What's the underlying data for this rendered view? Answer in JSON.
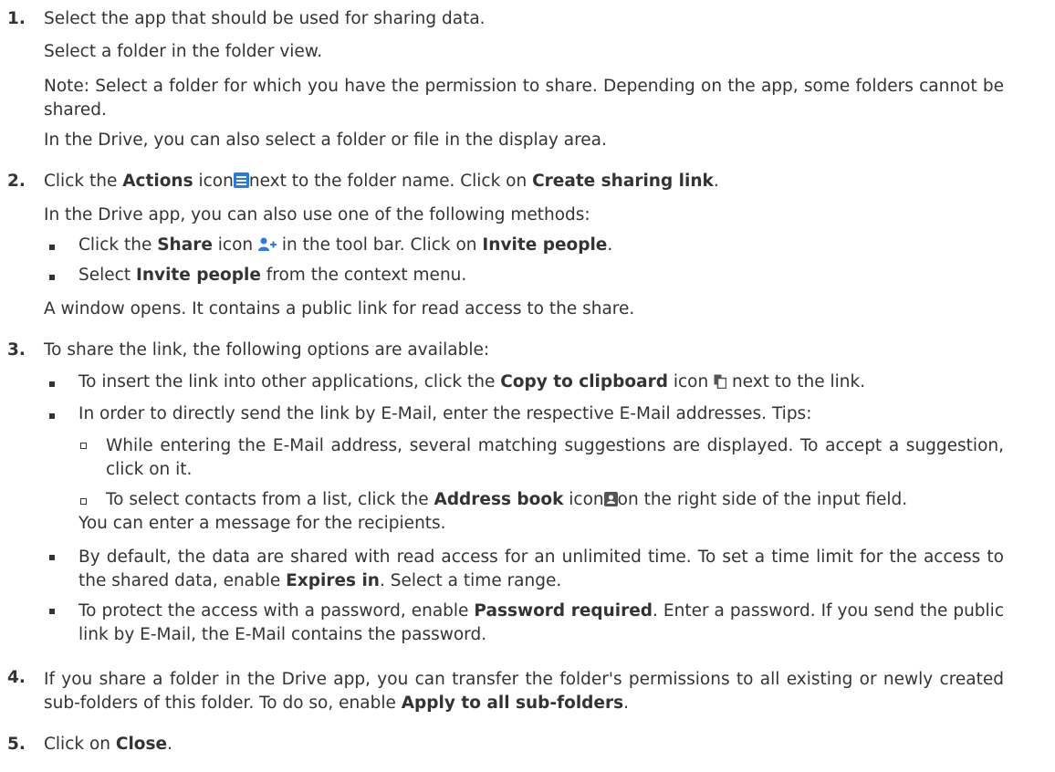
{
  "step1": {
    "number": "1.",
    "text": "Select the app that should be used for sharing data.",
    "select_folder": "Select a folder in the folder view.",
    "note": "Note: Select a folder for which you have the permission to share. Depending on the app, some folders cannot be shared.",
    "drive_note": "In the Drive, you can also select a folder or file in the display area."
  },
  "step2": {
    "number": "2.",
    "click": "Click the ",
    "actions": "Actions",
    "icon_word": " icon",
    "next_to": "next to the folder name. Click on ",
    "create_link": "Create sharing link",
    "period": ".",
    "drive_methods": "In the Drive app, you can also use one of the following methods:",
    "b1_click": "Click the ",
    "b1_share": "Share",
    "b1_icon": " icon ",
    "b1_toolbar": " in the tool bar. Click on ",
    "b1_invite": "Invite people",
    "b1_period": ".",
    "b2_select": "Select ",
    "b2_invite": "Invite people",
    "b2_rest": " from the context menu.",
    "window_opens": "A window opens. It contains a public link for read access to the share."
  },
  "step3": {
    "number": "3.",
    "intro": "To share the link, the following options are available:",
    "o1_a": "To insert the link into other applications, click the ",
    "o1_b": "Copy to clipboard",
    "o1_c": " icon ",
    "o1_d": " next to the link.",
    "o2": "In order to directly send the link by E-Mail, enter the respective E-Mail addresses. Tips:",
    "t1": "While entering the E-Mail address, several matching suggestions are displayed. To accept a suggestion, click on it.",
    "t2_a": "To select contacts from a list, click the ",
    "t2_b": "Address book",
    "t2_c": " icon",
    "t2_d": "on the right side of the input field.",
    "t2_e": "You can enter a message for the recipients.",
    "o3_a": "By default, the data are shared with read access for an unlimited time. To set a time limit for the access to the shared data, enable ",
    "o3_b": "Expires in",
    "o3_c": ". Select a time range.",
    "o4_a": "To protect the access with a password, enable ",
    "o4_b": "Password required",
    "o4_c": ". Enter a password. If you send the public link by E-Mail, the E-Mail contains the password."
  },
  "step4": {
    "number": "4.",
    "text": "If you share a folder in the Drive app, you can transfer the folder's permissions to all existing or newly created sub-folders of this folder. To do so, enable ",
    "apply": "Apply to all sub-folders",
    "period": "."
  },
  "step5": {
    "number": "5.",
    "click": "Click on ",
    "close": "Close",
    "period": "."
  },
  "colors": {
    "text": "#333333",
    "icon_blue": "#2a7ae2",
    "icon_gray": "#555555"
  },
  "icons": [
    "actions-icon",
    "share-icon",
    "copy-icon",
    "address-book-icon"
  ]
}
